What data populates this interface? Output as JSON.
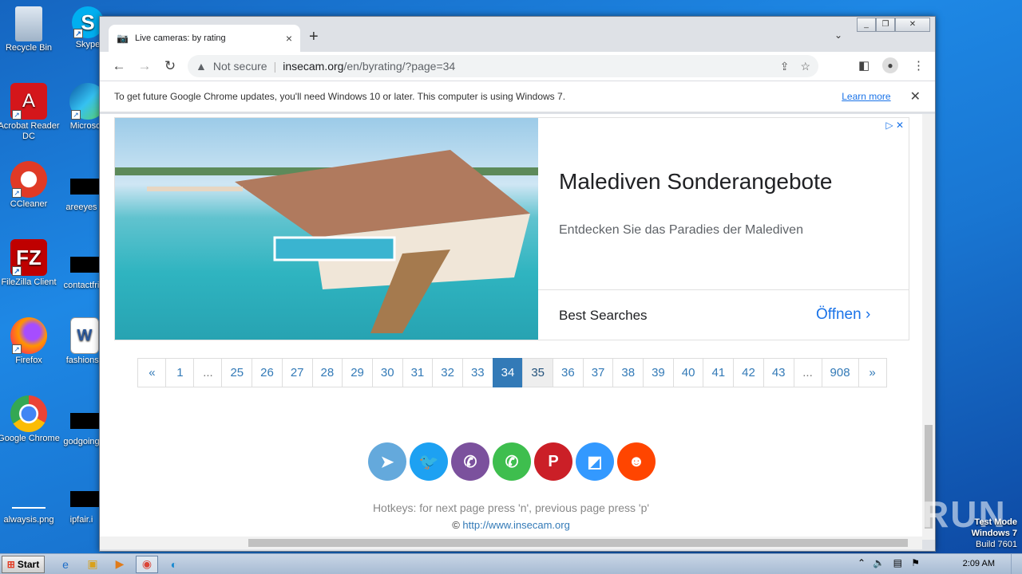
{
  "desktop": {
    "icons": [
      {
        "label": "Recycle Bin"
      },
      {
        "label": "Skype"
      },
      {
        "label": "Acrobat Reader DC"
      },
      {
        "label": "Microsoft"
      },
      {
        "label": "CCleaner"
      },
      {
        "label": "areeyes"
      },
      {
        "label": "FileZilla Client"
      },
      {
        "label": "contactfri"
      },
      {
        "label": "Firefox"
      },
      {
        "label": "fashionsy"
      },
      {
        "label": "Google Chrome"
      },
      {
        "label": "godgoing"
      },
      {
        "label": "alwaysis.png"
      },
      {
        "label": "ipfair.i"
      }
    ],
    "watermark": "ANY RUN",
    "test_mode": {
      "line1": "Test Mode",
      "line2": "Windows 7",
      "line3": "Build 7601"
    }
  },
  "browser": {
    "tab_title": "Live cameras: by rating",
    "tab_close": "×",
    "new_tab": "+",
    "security_label": "Not secure",
    "url_host": "insecam.org",
    "url_path": "/en/byrating/?page=34",
    "infobar": {
      "message": "To get future Google Chrome updates, you'll need Windows 10 or later. This computer is using Windows 7.",
      "link": "Learn more"
    }
  },
  "ad": {
    "title": "Malediven Sonderangebote",
    "subtitle": "Entdecken Sie das Paradies der Malediven",
    "best_searches": "Best Searches",
    "open_label": "Öffnen ›"
  },
  "pagination": {
    "items": [
      "«",
      "1",
      "...",
      "25",
      "26",
      "27",
      "28",
      "29",
      "30",
      "31",
      "32",
      "33",
      "34",
      "35",
      "36",
      "37",
      "38",
      "39",
      "40",
      "41",
      "42",
      "43",
      "...",
      "908",
      "»"
    ],
    "active": "34"
  },
  "share_buttons": [
    {
      "name": "telegram",
      "color": "#64a9dc"
    },
    {
      "name": "twitter",
      "color": "#1da1f2"
    },
    {
      "name": "viber",
      "color": "#7b519d"
    },
    {
      "name": "whatsapp",
      "color": "#3ebe4e"
    },
    {
      "name": "pinterest",
      "color": "#cb1f27"
    },
    {
      "name": "delicious",
      "color": "#3399ff"
    },
    {
      "name": "reddit",
      "color": "#ff4500"
    }
  ],
  "footer": {
    "hotkeys": "Hotkeys: for next page press 'n', previous page press 'p'",
    "copyright_symbol": "©",
    "site_link": "http://www.insecam.org"
  },
  "taskbar": {
    "start_label": "Start",
    "clock": "2:09 AM"
  }
}
